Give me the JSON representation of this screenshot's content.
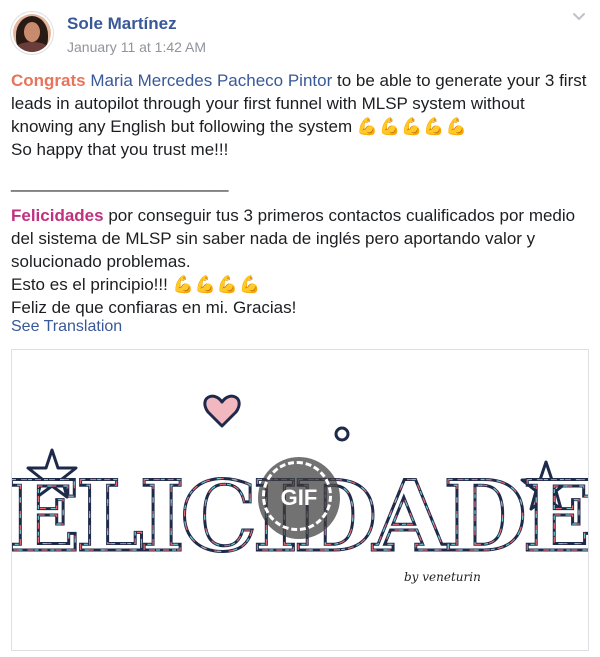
{
  "post": {
    "author": "Sole Martínez",
    "timestamp": "January 11 at 1:42 AM",
    "chevron_icon": "chevron-down-icon",
    "content": {
      "p1_highlight": "Congrats",
      "p1_mention": "Maria Mercedes Pacheco Pintor",
      "p1_text": " to be able to generate your 3 first leads in autopilot through your first funnel with MLSP system without knowing any English but following the system ",
      "p1_emoji": "💪💪💪💪💪",
      "p2_text": "So happy that you trust me!!!",
      "separator": "_______________________",
      "p3_highlight": "Felicidades",
      "p3_text": " por conseguir tus 3 primeros contactos cualificados por medio del sistema de MLSP sin saber nada de inglés pero aportando valor y solucionado problemas.",
      "p4_text": "Esto es el principio!!! ",
      "p4_emoji": "💪💪💪💪",
      "p5_text": "Feliz de que confiaras en mi. Gracias!"
    },
    "see_translation": "See Translation",
    "gif": {
      "badge_label": "GIF",
      "artwork_text": "FELICIDADES",
      "artist_signature": "by veneturin"
    }
  },
  "colors": {
    "link": "#385898",
    "highlight_en": "#e9745b",
    "highlight_es": "#c0307f",
    "meta": "#90949c"
  }
}
